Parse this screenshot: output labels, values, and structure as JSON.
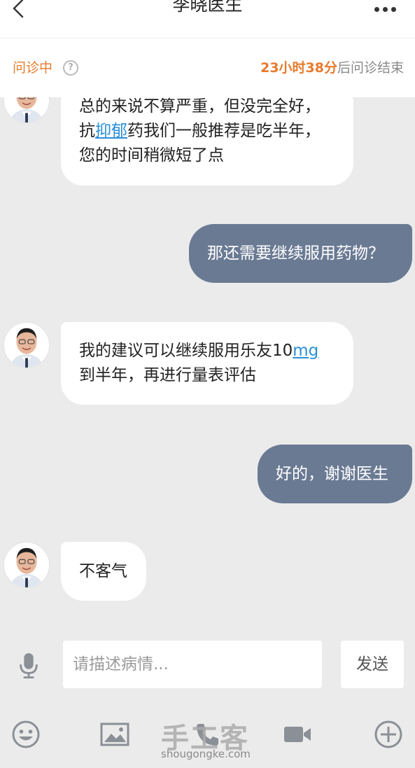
{
  "header": {
    "title": "李晓医生"
  },
  "consult": {
    "status": "问诊中",
    "remaining_time": "23小时38分",
    "remaining_suffix": "后问诊结束"
  },
  "messages": [
    {
      "from": "doctor",
      "line1": "总的来说不算严重，但没完全好，",
      "line2_pre": "抗",
      "line2_link": "抑郁",
      "line2_post": "药我们一般推荐是吃半年，",
      "line3": "您的时间稍微短了点"
    },
    {
      "from": "patient",
      "text": "那还需要继续服用药物？"
    },
    {
      "from": "doctor",
      "line1_pre": "我的建议可以继续服用乐友10",
      "line1_link": "mg",
      "line2": "到半年，再进行量表评估"
    },
    {
      "from": "patient",
      "text": "好的，谢谢医生"
    },
    {
      "from": "doctor",
      "text": "不客气"
    }
  ],
  "input": {
    "placeholder": "请描述病情...",
    "send_label": "发送"
  },
  "toolbar": {
    "icons": [
      "emoji-icon",
      "image-icon",
      "phone-icon",
      "video-icon",
      "plus-icon"
    ]
  },
  "watermark": {
    "logo": "手工客",
    "url": "shougongke.com"
  },
  "colors": {
    "accent": "#e87a2c",
    "outgoing_bubble": "#6a7a93",
    "link": "#2b8fd8",
    "background": "#ebebeb"
  }
}
